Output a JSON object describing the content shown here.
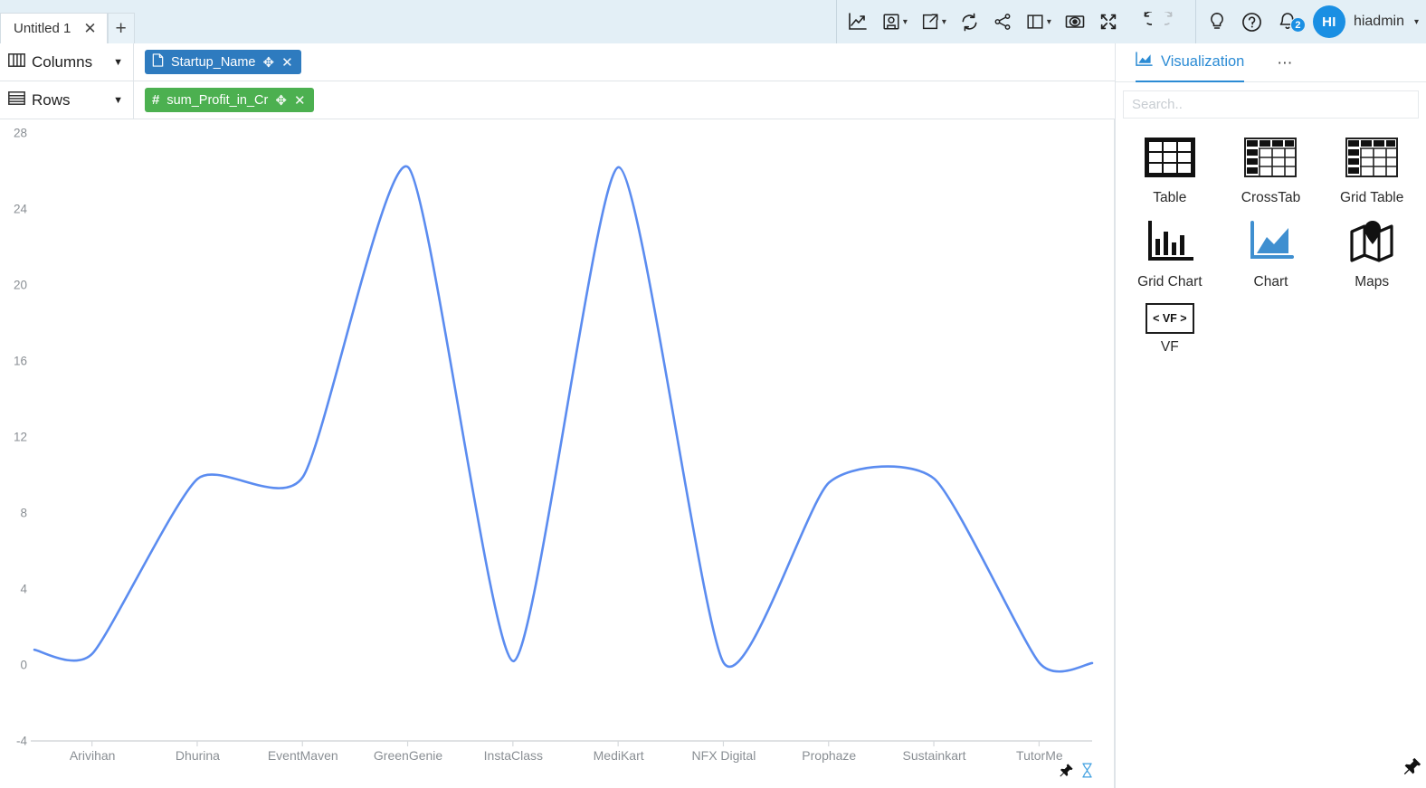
{
  "app": {
    "tab": {
      "title": "Untitled 1",
      "close_label": "✕"
    },
    "new_tab_label": "+"
  },
  "toolbar": {
    "items": [
      {
        "name": "chart-icon",
        "label": "Chart",
        "caret": false
      },
      {
        "name": "save-icon",
        "label": "Save",
        "caret": true
      },
      {
        "name": "export-icon",
        "label": "Export",
        "caret": true
      },
      {
        "name": "refresh-icon",
        "label": "Refresh",
        "caret": false
      },
      {
        "name": "share-icon",
        "label": "Share",
        "caret": false
      },
      {
        "name": "layout-icon",
        "label": "Layout",
        "caret": true
      },
      {
        "name": "preview-icon",
        "label": "Preview",
        "caret": false
      },
      {
        "name": "fullscreen-icon",
        "label": "Fullscreen",
        "caret": false
      },
      {
        "name": "undo-icon",
        "label": "Undo",
        "caret": false
      },
      {
        "name": "redo-icon",
        "label": "Redo",
        "caret": false
      }
    ],
    "bulb_label": "Insights",
    "help_label": "Help",
    "notifications_count": "2",
    "user": {
      "initials": "HI",
      "name": "hiadmin",
      "caret": "∨"
    }
  },
  "shelves": [
    {
      "label": "Columns",
      "icon": "columns-icon",
      "dropdown": "▼",
      "pill": {
        "text": "Startup_Name",
        "icon": "📄",
        "color": "#2e7bbf",
        "move": "✥",
        "remove": "✕"
      }
    },
    {
      "label": "Rows",
      "icon": "rows-icon",
      "dropdown": "▼",
      "pill": {
        "text": "sum_Profit_in_Cr",
        "icon": "#",
        "color": "#4cb050",
        "move": "✥",
        "remove": "✕"
      }
    }
  ],
  "chart_data": {
    "type": "line",
    "title": "",
    "xlabel": "",
    "ylabel": "",
    "line_color": "#5b8cf0",
    "grid": false,
    "legend": "none",
    "ylim": [
      -4,
      28
    ],
    "yticks": [
      28,
      24,
      20,
      16,
      12,
      8,
      4,
      0,
      -4
    ],
    "categories": [
      "Arivihan",
      "Dhurina",
      "EventMaven",
      "GreenGenie",
      "InstaClass",
      "MediKart",
      "NFX Digital",
      "Prophaze",
      "Sustainkart",
      "TutorMe"
    ],
    "values": [
      0.6,
      9.8,
      9.9,
      26.2,
      0.2,
      26.2,
      0.1,
      9.6,
      9.8,
      0.1
    ],
    "series": [
      {
        "name": "sum_Profit_in_Cr",
        "values": [
          0.6,
          9.8,
          9.9,
          26.2,
          0.2,
          26.2,
          0.1,
          9.6,
          9.8,
          0.1
        ]
      }
    ]
  },
  "footer": {
    "pin_icon": "pushpin-icon",
    "hourglass_icon": "hourglass-icon",
    "corner_pin_icon": "pushpin-icon"
  },
  "right_panel": {
    "tab_label": "Visualization",
    "more_label": "⋯",
    "search_placeholder": "Search..",
    "search_value": "",
    "items": [
      {
        "label": "Table",
        "icon": "table-icon"
      },
      {
        "label": "CrossTab",
        "icon": "crosstab-icon"
      },
      {
        "label": "Grid Table",
        "icon": "grid-table-icon"
      },
      {
        "label": "Grid Chart",
        "icon": "grid-chart-icon"
      },
      {
        "label": "Chart",
        "icon": "chart-icon"
      },
      {
        "label": "Maps",
        "icon": "maps-icon"
      },
      {
        "label": "VF",
        "icon": "vf-icon",
        "box_text": "< VF >"
      }
    ]
  }
}
